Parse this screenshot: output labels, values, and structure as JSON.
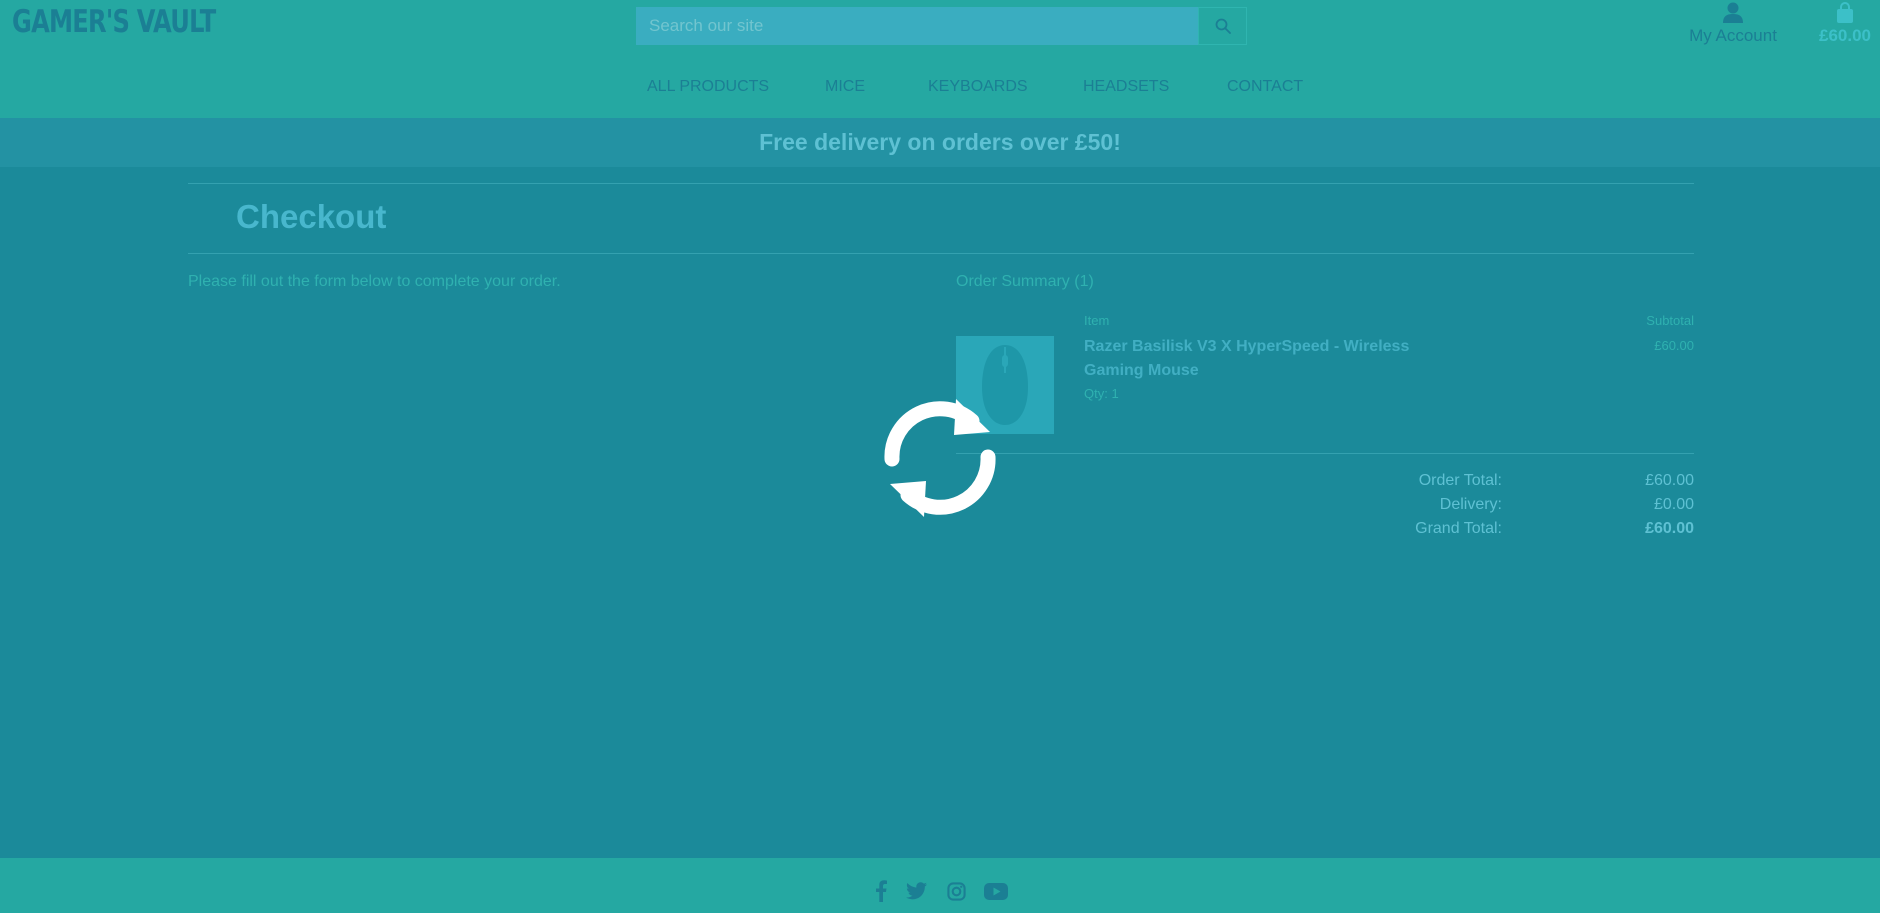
{
  "header": {
    "logo": "GAMER'S VAULT",
    "search_placeholder": "Search our site",
    "account_label": "My Account",
    "bag_total": "£60.00"
  },
  "nav": {
    "items": [
      "ALL PRODUCTS",
      "MICE",
      "KEYBOARDS",
      "HEADSETS",
      "CONTACT"
    ]
  },
  "banner": {
    "text": "Free delivery on orders over £50!"
  },
  "checkout": {
    "title": "Checkout",
    "intro": "Please fill out the form below to complete your order.",
    "summary_heading": "Order Summary (1)",
    "col_item": "Item",
    "col_subtotal": "Subtotal",
    "product": {
      "name": "Razer Basilisk V3 X HyperSpeed - Wireless Gaming Mouse",
      "qty": "Qty: 1",
      "price": "£60.00"
    },
    "totals": {
      "order_total_label": "Order Total:",
      "order_total": "£60.00",
      "delivery_label": "Delivery:",
      "delivery": "£0.00",
      "grand_total_label": "Grand Total:",
      "grand_total": "£60.00"
    }
  },
  "footer": {
    "social_icons": [
      "facebook-icon",
      "twitter-icon",
      "instagram-icon",
      "youtube-icon"
    ]
  },
  "overlay": {
    "icon": "loading-spinner-icon"
  },
  "colors": {
    "header_bg": "#25a8a2",
    "page_bg": "#1b8a9a",
    "banner_bg": "#2392a3",
    "accent": "#1b7f94"
  }
}
